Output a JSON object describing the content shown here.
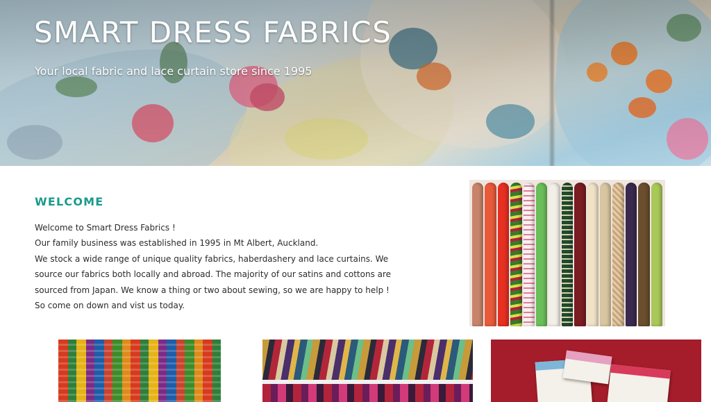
{
  "hero": {
    "title": "SMART DRESS FABRICS",
    "subtitle": "Your local fabric and lace curtain store since 1995"
  },
  "welcome": {
    "heading": "WELCOME",
    "lines": [
      "Welcome to Smart Dress Fabrics !",
      "Our family business was established in 1995 in Mt Albert, Auckland.",
      "We stock a wide range of unique quality fabrics, haberdashery and lace curtains. We",
      "source our fabrics both locally and abroad. The majority of our satins and cottons are",
      "sourced from Japan. We know a thing or two about sewing, so we are happy to help !",
      "So come on down and vist us today."
    ]
  },
  "images": {
    "hero": "floral-fabric-photo",
    "rolls": "fabric-rolls-photo",
    "thumb_1": "printed-fabrics-photo",
    "thumb_2": "fabric-shelves-photo",
    "thumb_3": "sewing-magazines-photo"
  },
  "colors": {
    "accent": "#1a9a8c",
    "text": "#2b2b2b",
    "hero_text": "#ffffff"
  }
}
